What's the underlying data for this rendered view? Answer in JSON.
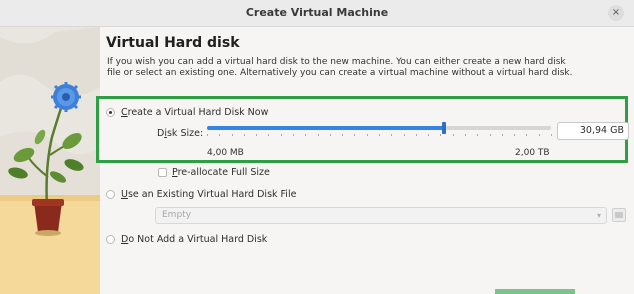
{
  "window": {
    "title": "Create Virtual Machine",
    "close_symbol": "×"
  },
  "page": {
    "title": "Virtual Hard disk",
    "description": "If you wish you can add a virtual hard disk to the new machine. You can either create a new hard disk file or select an existing one. Alternatively you can create a virtual machine without a virtual hard disk."
  },
  "options": {
    "create_now": {
      "prefix": "",
      "mnemonic": "C",
      "rest": "reate a Virtual Hard Disk Now",
      "selected": true
    },
    "use_existing": {
      "prefix": "",
      "mnemonic": "U",
      "rest": "se an Existing Virtual Hard Disk File",
      "selected": false
    },
    "do_not_add": {
      "prefix": "",
      "mnemonic": "D",
      "rest": "o Not Add a Virtual Hard Disk",
      "selected": false
    }
  },
  "disk_size": {
    "label_pre": "D",
    "label_mnemonic": "i",
    "label_post": "sk Size:",
    "value": "30,94 GB",
    "min_label": "4,00 MB",
    "max_label": "2,00 TB",
    "slider_fraction": 0.69
  },
  "preallocate": {
    "pre": "",
    "mnemonic": "P",
    "rest": "re-allocate Full Size",
    "checked": false
  },
  "existing_file": {
    "value": "Empty"
  },
  "colors": {
    "accent": "#3584e4",
    "highlight": "#2ea043"
  }
}
